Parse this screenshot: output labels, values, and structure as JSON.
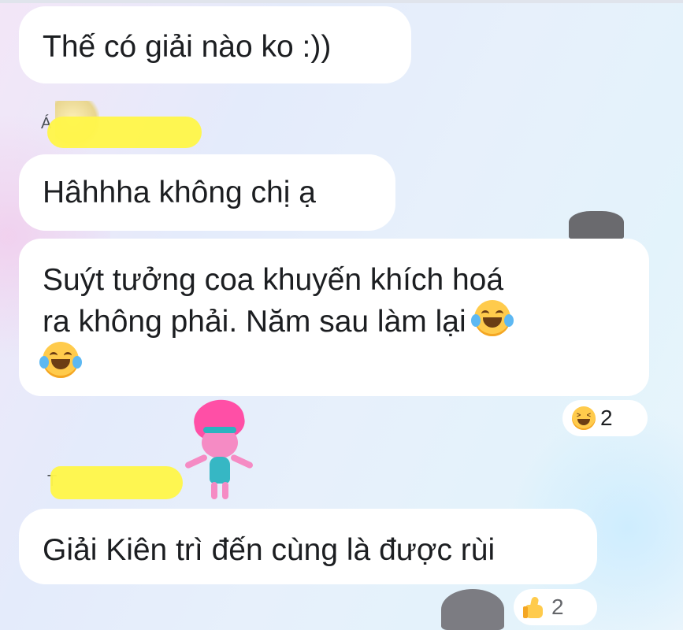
{
  "messages": [
    {
      "text": "Thế có giải nào ko :))"
    },
    {
      "sender": "Á",
      "text": "Hâhhha không chị ạ"
    },
    {
      "line1": "Suýt tưởng coa khuyến khích hoá",
      "line2": "ra không phải. Năm sau làm lại"
    },
    {
      "sender": "T",
      "text": "Giải Kiên trì đến cùng là được rùi"
    }
  ],
  "reactions": [
    {
      "icon": "laughing-emoji-icon",
      "count": "2"
    },
    {
      "icon": "thumbs-up-icon",
      "count": "2"
    }
  ],
  "colors": {
    "bubble": "#ffffff",
    "redaction": "#fff64a",
    "text": "#1c1e21"
  }
}
